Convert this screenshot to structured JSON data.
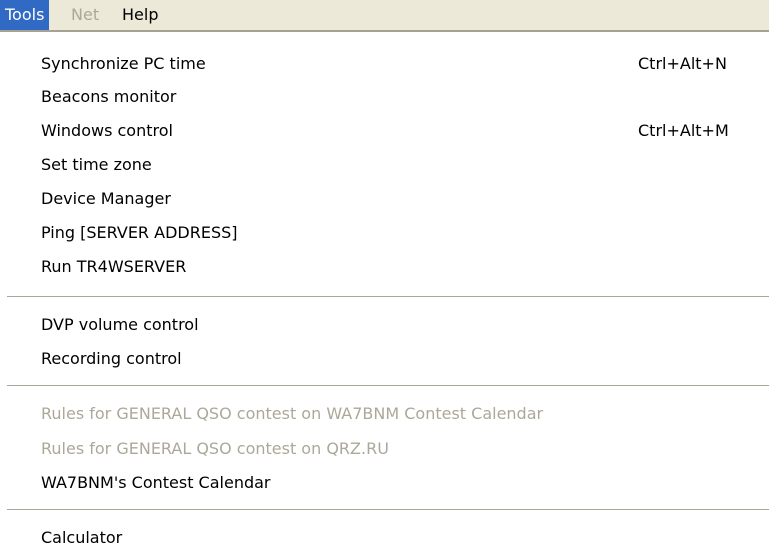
{
  "menubar": {
    "tools": "Tools",
    "net": "Net",
    "help": "Help"
  },
  "menu": {
    "sync_pc_time": {
      "label": "Synchronize PC time",
      "shortcut": "Ctrl+Alt+N"
    },
    "beacons_monitor": {
      "label": "Beacons monitor"
    },
    "windows_control": {
      "label": "Windows control",
      "shortcut": "Ctrl+Alt+M"
    },
    "set_time_zone": {
      "label": "Set time zone"
    },
    "device_manager": {
      "label": "Device Manager"
    },
    "ping_server": {
      "label": "Ping [SERVER ADDRESS]"
    },
    "run_tr4wserver": {
      "label": "Run TR4WSERVER"
    },
    "dvp_volume": {
      "label": "DVP volume control"
    },
    "recording_control": {
      "label": "Recording control"
    },
    "rules_wa7bnm": {
      "label": "Rules for GENERAL QSO contest on WA7BNM Contest Calendar"
    },
    "rules_qrz": {
      "label": "Rules for GENERAL QSO contest on QRZ.RU"
    },
    "wa7bnm_calendar": {
      "label": "WA7BNM's Contest Calendar"
    },
    "calculator": {
      "label": "Calculator"
    }
  }
}
